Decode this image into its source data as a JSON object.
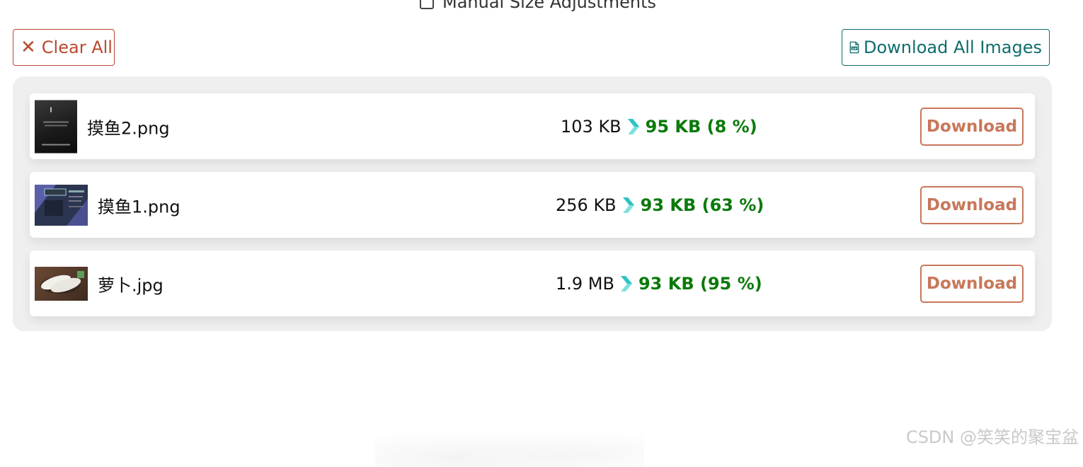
{
  "manual_size": {
    "label": "Manual Size Adjustments",
    "checked": false
  },
  "toolbar": {
    "clear_label": "Clear All",
    "download_all_label": "Download All Images"
  },
  "files": [
    {
      "name": "摸鱼2.png",
      "original_size": "103 KB",
      "compressed": "95 KB (8 %)",
      "download_label": "Download"
    },
    {
      "name": "摸鱼1.png",
      "original_size": "256 KB",
      "compressed": "93 KB (63 %)",
      "download_label": "Download"
    },
    {
      "name": "萝卜.jpg",
      "original_size": "1.9 MB",
      "compressed": "93 KB (95 %)",
      "download_label": "Download"
    }
  ],
  "colors": {
    "clear": "#b84a2e",
    "download_all": "#0f6d6d",
    "download": "#c8775a",
    "saved": "#0b7a0b",
    "chevron": "#2ec4c4"
  },
  "icons": {
    "clear": "close-icon",
    "download_all": "zip-file-icon",
    "arrow": "chevron-right-icon"
  },
  "watermark": "CSDN @笑笑的聚宝盆"
}
